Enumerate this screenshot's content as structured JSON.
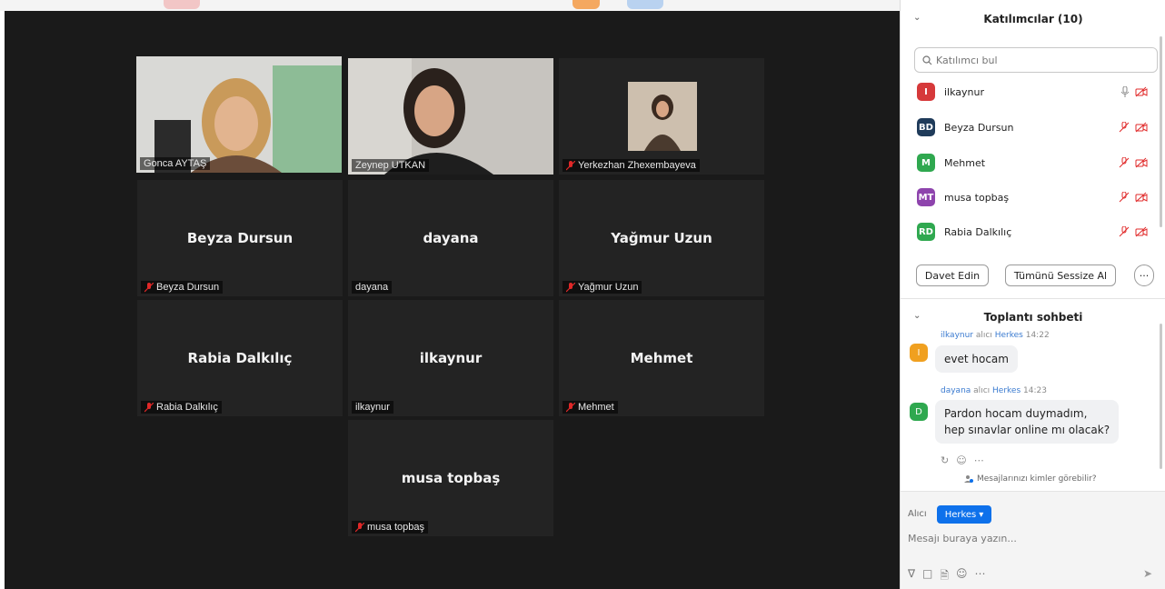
{
  "participants_panel": {
    "title": "Katılımcılar (10)",
    "search_placeholder": "Katılımcı bul",
    "list": [
      {
        "initials": "I",
        "name": "ilkaynur",
        "color": "#d6393a",
        "mic": "on"
      },
      {
        "initials": "BD",
        "name": "Beyza Dursun",
        "color": "#1f3b5a",
        "mic": "muted"
      },
      {
        "initials": "M",
        "name": "Mehmet",
        "color": "#2fa84f",
        "mic": "muted"
      },
      {
        "initials": "MT",
        "name": "musa topbaş",
        "color": "#8e44ad",
        "mic": "muted"
      },
      {
        "initials": "RD",
        "name": "Rabia Dalkılıç",
        "color": "#2fa84f",
        "mic": "muted"
      }
    ],
    "invite_label": "Davet Edin",
    "mute_all_label": "Tümünü Sessize Al",
    "more_label": "···"
  },
  "chat": {
    "title": "Toplantı sohbeti",
    "messages": [
      {
        "sender": "ilkaynur",
        "to_word": "alıcı",
        "recipient": "Herkes",
        "time": "14:22",
        "avatar": "I",
        "avatar_color": "#f0a020",
        "text": "evet hocam"
      },
      {
        "sender": "dayana",
        "to_word": "alıcı",
        "recipient": "Herkes",
        "time": "14:23",
        "avatar": "D",
        "avatar_color": "#2fa84f",
        "text": "Pardon hocam duymadım,",
        "text2": "hep sınavlar online mı olacak?"
      }
    ],
    "visibility_note": "Mesajlarınızı kimler görebilir?",
    "to_label": "Alıcı",
    "to_button": "Herkes",
    "input_placeholder": "Mesajı buraya yazın..."
  },
  "video_tiles": [
    {
      "name": "Gonca AYTAŞ",
      "type": "video",
      "muted": false,
      "active": true
    },
    {
      "name": "Zeynep UTKAN",
      "type": "video",
      "muted": false,
      "active": false
    },
    {
      "name": "Yerkezhan Zhexembayeva",
      "type": "photo",
      "muted": true,
      "active": false
    },
    {
      "name": "Beyza Dursun",
      "center": "Beyza Dursun",
      "muted": true
    },
    {
      "name": "dayana",
      "center": "dayana",
      "muted": false
    },
    {
      "name": "Yağmur Uzun",
      "center": "Yağmur Uzun",
      "muted": true
    },
    {
      "name": "Rabia Dalkılıç",
      "center": "Rabia Dalkılıç",
      "muted": true
    },
    {
      "name": "ilkaynur",
      "center": "ilkaynur",
      "muted": false
    },
    {
      "name": "Mehmet",
      "center": "Mehmet",
      "muted": true
    },
    {
      "name": "musa  topbaş",
      "center": "musa  topbaş",
      "muted": true
    }
  ],
  "colors": {
    "active_border": "#b6e04b",
    "mute_red": "#e02828",
    "accent": "#0e71eb"
  }
}
